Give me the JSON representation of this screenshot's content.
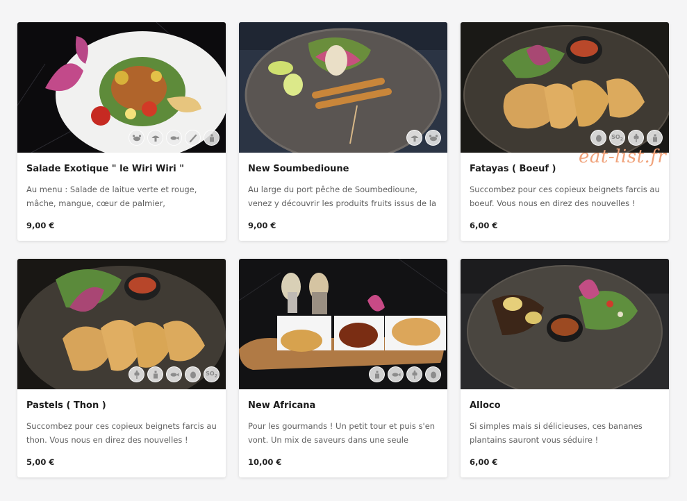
{
  "watermark": "eat-list.fr",
  "dishes": [
    {
      "name": "Salade Exotique \" le Wiri Wiri \"",
      "description": "Au menu : Salade de laitue verte et rouge, mâche, mangue, cœur de palmier, concombre,...",
      "price": "9,00 €",
      "allergens": [
        "crab-icon",
        "mushroom-icon",
        "fish-icon",
        "fork-icon",
        "bottle-icon"
      ]
    },
    {
      "name": "New Soumbedioune",
      "description": "Au large du port pêche de Soumbedioune, venez y découvrir les produits fruits issus de la pêche...",
      "price": "9,00 €",
      "allergens": [
        "mushroom-icon",
        "crab-icon"
      ]
    },
    {
      "name": "Fatayas ( Boeuf )",
      "description": "Succombez pour ces copieux beignets farcis au boeuf. Vous nous en direz des nouvelles !",
      "price": "6,00 €",
      "allergens": [
        "egg-icon",
        "so2",
        "wheat-icon",
        "bottle-icon"
      ]
    },
    {
      "name": "Pastels ( Thon )",
      "description": "Succombez pour ces copieux beignets farcis au thon. Vous nous en direz des nouvelles !",
      "price": "5,00 €",
      "allergens": [
        "wheat-icon",
        "bottle-icon",
        "fish-icon",
        "egg-icon",
        "so2"
      ]
    },
    {
      "name": "New Africana",
      "description": "Pour les gourmands ! Un petit tour et puis s'en vont. Un mix de saveurs dans une seule assiett...",
      "price": "10,00 €",
      "allergens": [
        "bottle-icon",
        "fish-icon",
        "wheat-icon",
        "egg-icon"
      ]
    },
    {
      "name": "Alloco",
      "description": "Si simples mais si délicieuses, ces bananes plantains sauront vous séduire !",
      "price": "6,00 €",
      "allergens": []
    }
  ]
}
